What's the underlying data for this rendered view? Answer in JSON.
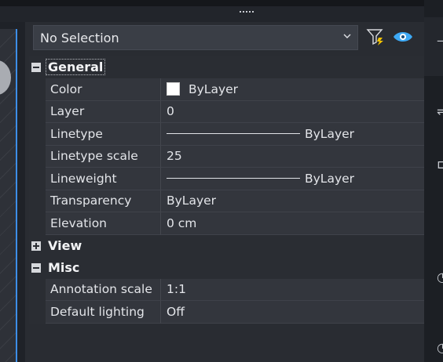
{
  "selector": {
    "value": "No Selection"
  },
  "toolbar": {
    "filter_icon": "quick-select-filter-icon",
    "eye_icon": "eye-icon"
  },
  "sections": {
    "general": {
      "label": "General",
      "expanded": true
    },
    "view": {
      "label": "View",
      "expanded": false
    },
    "misc": {
      "label": "Misc",
      "expanded": true
    }
  },
  "general_rows": [
    {
      "name": "Color",
      "value": "ByLayer",
      "swatch_color": "#ffffff"
    },
    {
      "name": "Layer",
      "value": "0"
    },
    {
      "name": "Linetype",
      "value": "ByLayer"
    },
    {
      "name": "Linetype scale",
      "value": "25"
    },
    {
      "name": "Lineweight",
      "value": "ByLayer"
    },
    {
      "name": "Transparency",
      "value": "ByLayer"
    },
    {
      "name": "Elevation",
      "value": "0 cm"
    }
  ],
  "misc_rows": [
    {
      "name": "Annotation scale",
      "value": "1:1"
    },
    {
      "name": "Default lighting",
      "value": "Off"
    }
  ],
  "colors": {
    "panel_bg": "#292c32",
    "row_bg": "#33363d",
    "accent_blue": "#3d8ee8",
    "eye_blue": "#3da9f5",
    "filter_yellow": "#f2c200"
  }
}
